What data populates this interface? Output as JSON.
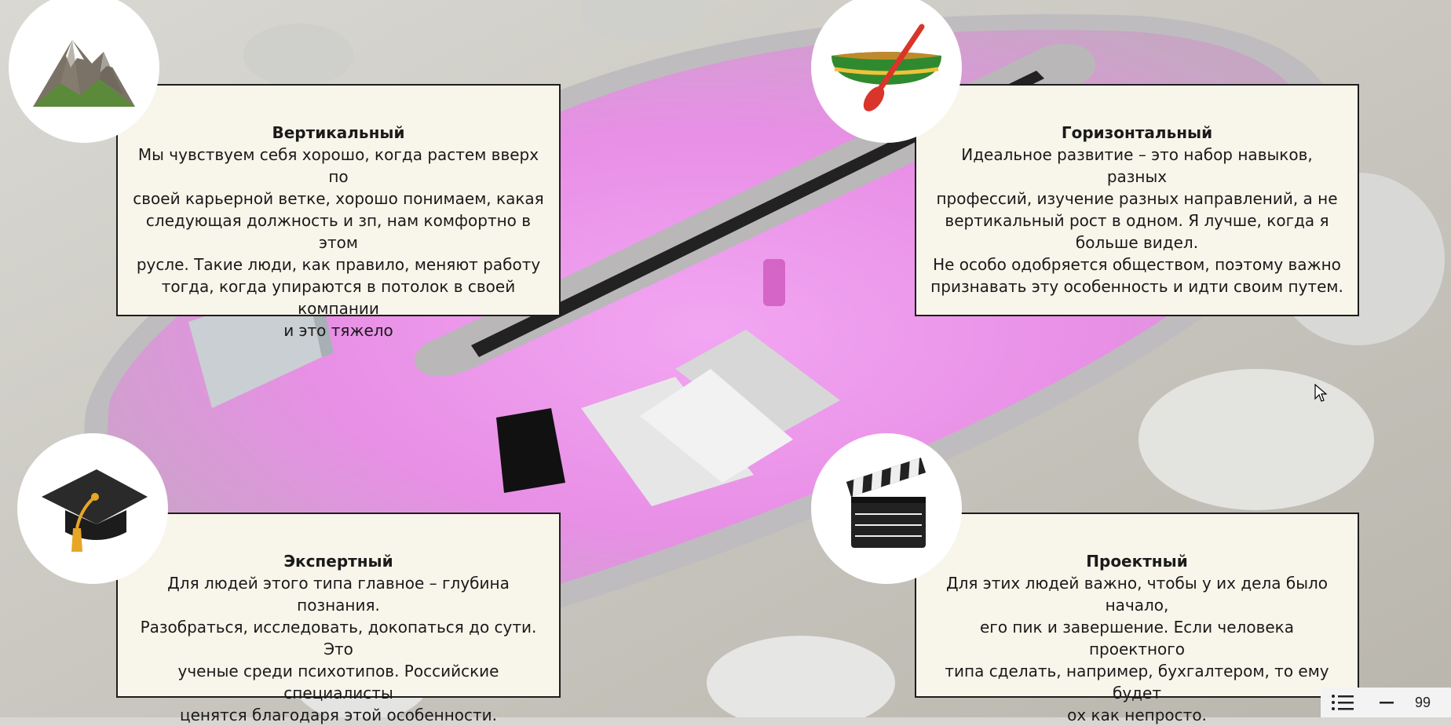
{
  "cards": {
    "vertical": {
      "title": "Вертикальный",
      "body": "Мы чувствуем себя хорошо, когда растем вверх по\nсвоей карьерной ветке, хорошо понимаем, какая\nследующая должность и зп, нам комфортно в этом\nрусле. Такие люди, как правило, меняют работу\nтогда, когда упираются в потолок в своей компании\nи это тяжело"
    },
    "horizontal": {
      "title": "Горизонтальный",
      "body": "Идеальное развитие – это набор навыков, разных\nпрофессий, изучение разных направлений, а не\nвертикальный рост в одном. Я лучше, когда я\nбольше видел.\nНе особо одобряется обществом, поэтому важно\nпризнавать эту особенность и идти своим путем."
    },
    "expert": {
      "title": "Экспертный",
      "body": "Для людей этого типа главное – глубина познания.\nРазобраться, исследовать, докопаться до сути. Это\nученые среди психотипов. Российские специалисты\nценятся благодаря этой особенности."
    },
    "project": {
      "title": "Проектный",
      "body": "Для этих людей важно, чтобы у их дела было начало,\nего пик и завершение. Если человека проектного\nтипа сделать, например, бухгалтером, то ему будет\nох как непросто."
    }
  },
  "icons": {
    "vertical": "mountain-icon",
    "horizontal": "canoe-icon",
    "expert": "graduation-cap-icon",
    "project": "clapperboard-icon"
  },
  "viewer": {
    "outline_icon": "list-icon",
    "zoom_out_icon": "minus-icon",
    "zoom_text": "99"
  },
  "colors": {
    "card_bg": "#f8f5ea",
    "card_border": "#1d1d1d",
    "table_glow": "#e87ee8"
  }
}
